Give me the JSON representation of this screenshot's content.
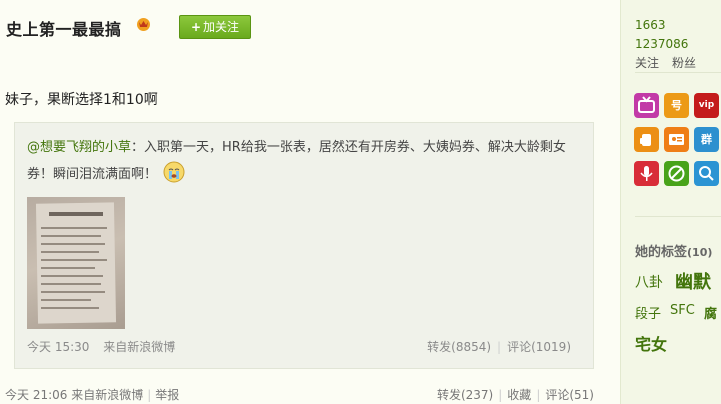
{
  "header": {
    "name": "史上第一最最搞",
    "follow_label": "加关注",
    "follow_plus": "+"
  },
  "post": {
    "text": "妹子，果断选择1和10啊",
    "quote": {
      "user": "@想要飞翔的小草",
      "sep": "：",
      "text": "入职第一天，HR给我一张表，居然还有开房券、大姨妈券、解决大龄剩女券！瞬间泪流满面啊！",
      "time": "今天 15:30",
      "source": "来自新浪微博",
      "repost": "转发(8854)",
      "comment": "评论(1019)"
    },
    "footer": {
      "time": "今天 21:06",
      "source": "来自新浪微博",
      "report": "举报",
      "repost": "转发(237)",
      "fav": "收藏",
      "comment": "评论(51)"
    }
  },
  "side": {
    "follow_count": "1663",
    "fans_count": "1237086",
    "follow_label": "关注",
    "fans_label": "粉丝",
    "tags_title": "她的标签",
    "tags_count": "(10)",
    "tags": [
      "八卦",
      "幽默",
      "段子",
      "SFC",
      "腐",
      "宅女"
    ],
    "icon_labels": [
      "号",
      "vip",
      "群"
    ]
  },
  "colors": {
    "accent": "#43750c",
    "button": "#6aaa1d",
    "sidebar": "#f3f7e6"
  }
}
